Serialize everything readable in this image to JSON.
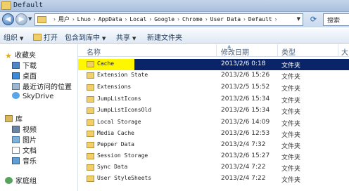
{
  "window": {
    "title": "Default"
  },
  "address": {
    "segments": [
      "用户",
      "Lhuo",
      "AppData",
      "Local",
      "Google",
      "Chrome",
      "User Data",
      "Default"
    ],
    "search_label": "搜索"
  },
  "toolbar": {
    "organize": "组织",
    "open": "打开",
    "include_in_library": "包含到库中",
    "share": "共享",
    "new_folder": "新建文件夹"
  },
  "nav": {
    "favorites": "收藏夹",
    "downloads": "下载",
    "desktop": "桌面",
    "recent": "最近访问的位置",
    "skydrive": "SkyDrive",
    "libraries": "库",
    "videos": "视频",
    "pictures": "图片",
    "documents": "文档",
    "music": "音乐",
    "homegroup": "家庭组"
  },
  "columns": {
    "name": "名称",
    "modified": "修改日期",
    "type": "类型",
    "size": "大"
  },
  "files": [
    {
      "name": "Cache",
      "modified": "2013/2/6 0:18",
      "type": "文件夹"
    },
    {
      "name": "Extension State",
      "modified": "2013/2/6 15:26",
      "type": "文件夹"
    },
    {
      "name": "Extensions",
      "modified": "2013/2/5 15:52",
      "type": "文件夹"
    },
    {
      "name": "JumpListIcons",
      "modified": "2013/2/6 15:34",
      "type": "文件夹"
    },
    {
      "name": "JumpListIconsOld",
      "modified": "2013/2/6 15:34",
      "type": "文件夹"
    },
    {
      "name": "Local Storage",
      "modified": "2013/2/6 14:09",
      "type": "文件夹"
    },
    {
      "name": "Media Cache",
      "modified": "2013/2/6 12:53",
      "type": "文件夹"
    },
    {
      "name": "Pepper Data",
      "modified": "2013/2/4 7:32",
      "type": "文件夹"
    },
    {
      "name": "Session Storage",
      "modified": "2013/2/6 15:27",
      "type": "文件夹"
    },
    {
      "name": "Sync Data",
      "modified": "2013/2/4 7:22",
      "type": "文件夹"
    },
    {
      "name": "User StyleSheets",
      "modified": "2013/2/4 7:22",
      "type": "文件夹"
    }
  ],
  "selected_index": 0,
  "colors": {
    "selection": "#0a246a",
    "highlight": "#fff700",
    "folder": "#f0cf6a"
  }
}
